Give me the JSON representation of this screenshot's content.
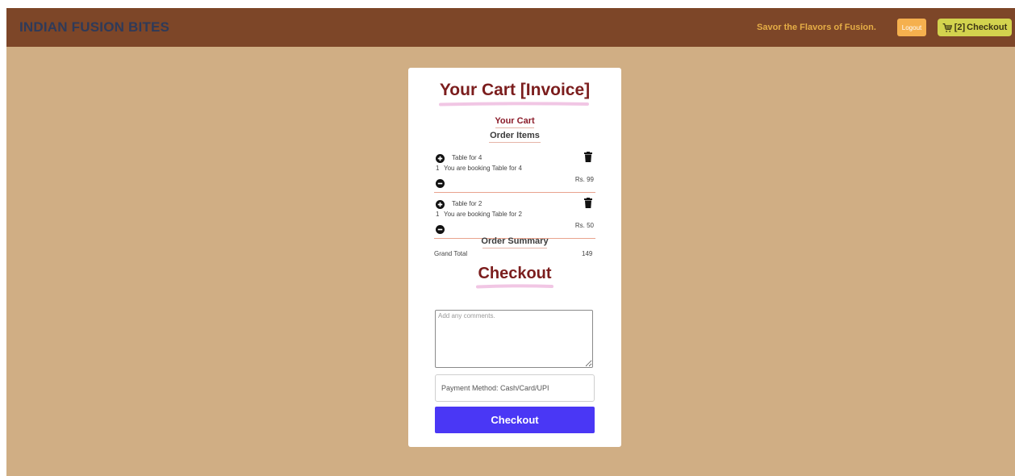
{
  "navbar": {
    "brand": "INDIAN FUSION BITES",
    "tagline": "Savor the Flavors of Fusion.",
    "logout_label": "Logout",
    "cart_count": "[2]",
    "checkout_label": "Checkout"
  },
  "cart": {
    "title": "Your Cart [Invoice]",
    "subtitle": "Your Cart",
    "order_items_heading": "Order Items",
    "items": [
      {
        "name": "Table for 4",
        "quantity": "1",
        "description": "You are booking Table for 4",
        "price": "Rs. 99"
      },
      {
        "name": "Table for 2",
        "quantity": "1",
        "description": "You are booking Table for 2",
        "price": "Rs. 50"
      }
    ],
    "order_summary_heading": "Order Summary",
    "grand_total_label": "Grand Total",
    "grand_total_value": "149"
  },
  "checkout": {
    "title": "Checkout",
    "comments_placeholder": "Add any comments.",
    "payment_placeholder": "Payment Method: Cash/Card/UPI",
    "button_label": "Checkout"
  },
  "colors": {
    "page_background": "#d0ae84",
    "navbar_background": "#7d4628",
    "heading": "#7b1d1d",
    "checkout_button": "#4a37f5",
    "logout_button": "#f5b04e",
    "cart_button": "#d3d34e"
  },
  "icons": {
    "cart": "shopping-cart-icon",
    "add": "plus-circle-icon",
    "remove": "minus-circle-icon",
    "delete": "trash-icon"
  }
}
